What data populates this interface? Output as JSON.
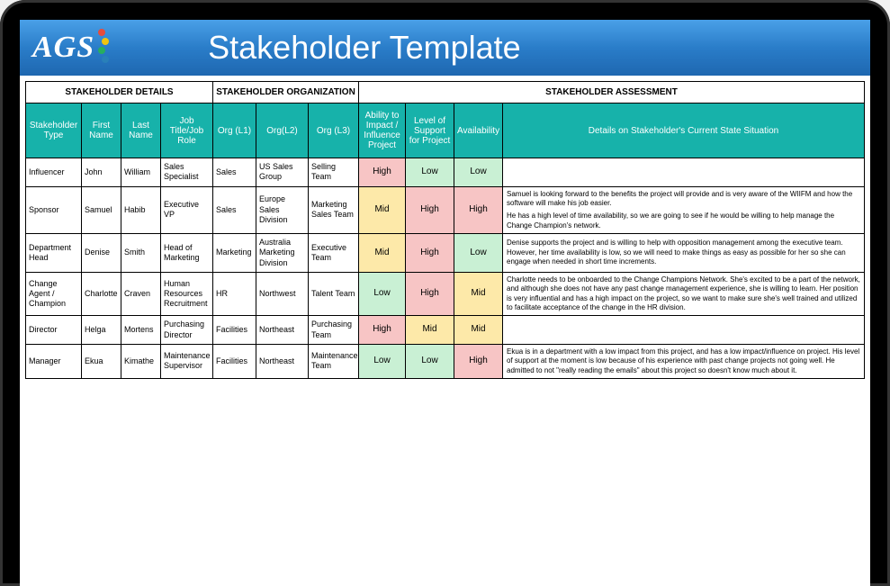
{
  "header": {
    "logo_text": "AGS",
    "title": "Stakeholder Template"
  },
  "sections": {
    "details": "STAKEHOLDER DETAILS",
    "organization": "STAKEHOLDER ORGANIZATION",
    "assessment": "STAKEHOLDER ASSESSMENT"
  },
  "columns": {
    "type": "Stakeholder Type",
    "first": "First Name",
    "last": "Last Name",
    "job": "Job Title/Job Role",
    "l1": "Org (L1)",
    "l2": "Org(L2)",
    "l3": "Org (L3)",
    "impact": "Ability to Impact / Influence Project",
    "support": "Level of Support for Project",
    "avail": "Availability",
    "details": "Details on Stakeholder's Current State Situation"
  },
  "levels": {
    "High": "High",
    "Mid": "Mid",
    "Low": "Low"
  },
  "rows": [
    {
      "type": "Influencer",
      "first": "John",
      "last": "William",
      "job": "Sales Specialist",
      "l1": "Sales",
      "l2": "US Sales Group",
      "l3": "Selling Team",
      "impact": "High",
      "support": "Low",
      "avail": "Low",
      "details": ""
    },
    {
      "type": "Sponsor",
      "first": "Samuel",
      "last": "Habib",
      "job": "Executive VP",
      "l1": "Sales",
      "l2": "Europe Sales Division",
      "l3": "Marketing Sales Team",
      "impact": "Mid",
      "support": "High",
      "avail": "High",
      "details": "Samuel is looking forward to the benefits the project will provide and is very aware of the WIIFM and how the software will make his job easier.\n\nHe has a high level of time availability, so we are going to see if he would be willing to help manage the Change Champion's network."
    },
    {
      "type": "Department Head",
      "first": "Denise",
      "last": "Smith",
      "job": "Head of Marketing",
      "l1": "Marketing",
      "l2": "Australia Marketing Division",
      "l3": "Executive Team",
      "impact": "Mid",
      "support": "High",
      "avail": "Low",
      "details": "Denise supports the project and is willing to help with opposition management among the executive team. However, her time availability is low, so we will need to make things as easy as possible for her so she can engage when needed in short time increments."
    },
    {
      "type": "Change Agent / Champion",
      "first": "Charlotte",
      "last": "Craven",
      "job": "Human Resources Recruitment",
      "l1": "HR",
      "l2": "Northwest",
      "l3": "Talent Team",
      "impact": "Low",
      "support": "High",
      "avail": "Mid",
      "details": "Charlotte needs to be onboarded to the Change Champions Network. She's excited to be a part of the network, and although she does not have any past change management experience, she is willing to learn. Her position is very influential and has a high impact on the project, so we want to make sure she's well trained and utilized to facilitate acceptance of the change in the HR division."
    },
    {
      "type": "Director",
      "first": "Helga",
      "last": "Mortens",
      "job": "Purchasing Director",
      "l1": "Facilities",
      "l2": "Northeast",
      "l3": "Purchasing Team",
      "impact": "High",
      "support": "Mid",
      "avail": "Mid",
      "details": ""
    },
    {
      "type": "Manager",
      "first": "Ekua",
      "last": "Kimathe",
      "job": "Maintenance Supervisor",
      "l1": "Facilities",
      "l2": "Northeast",
      "l3": "Maintenance Team",
      "impact": "Low",
      "support": "Low",
      "avail": "High",
      "details": "Ekua is in a department with a low impact from this project, and has a low impact/influence on project. His level of support at the moment is low because of his experience with past change projects not going well. He admitted to not \"really reading the emails\" about this project so doesn't know much about it."
    }
  ]
}
